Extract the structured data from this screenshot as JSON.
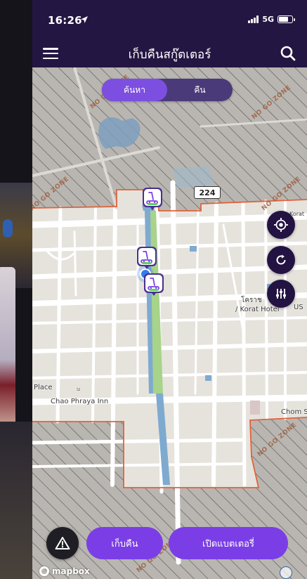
{
  "status_bar": {
    "time": "16:26",
    "network": "5G"
  },
  "nav": {
    "title": "เก็บคืนสกู๊ตเตอร์"
  },
  "mode_toggle": {
    "tabs": [
      {
        "label": "ค้นหา",
        "active": true
      },
      {
        "label": "คืน",
        "active": false
      }
    ]
  },
  "map": {
    "road_shield": "224",
    "labels": {
      "hotel": "โคราช",
      "hotel_en": "/ Korat Hotel",
      "place": "Place",
      "inn": "Chao Phraya Inn",
      "chom": "Chom S",
      "us": "US",
      "korat_partial": "Korat",
      "dot_mark": "ಜ"
    },
    "zone_label": "NO GO ZONE",
    "colors": {
      "zone_border": "#e0623a",
      "zone_hatch": "#5a5a5a",
      "canal": "#7faad0",
      "park": "#a7d38a",
      "accent": "#7b3ee6",
      "header": "#241642"
    },
    "scooter_count": 3
  },
  "actions": {
    "warning_icon": "warning-triangle-icon",
    "collect_label": "เก็บคืน",
    "battery_label": "เปิดแบตเตอรี่"
  },
  "attribution": {
    "logo_text": "mapbox"
  }
}
